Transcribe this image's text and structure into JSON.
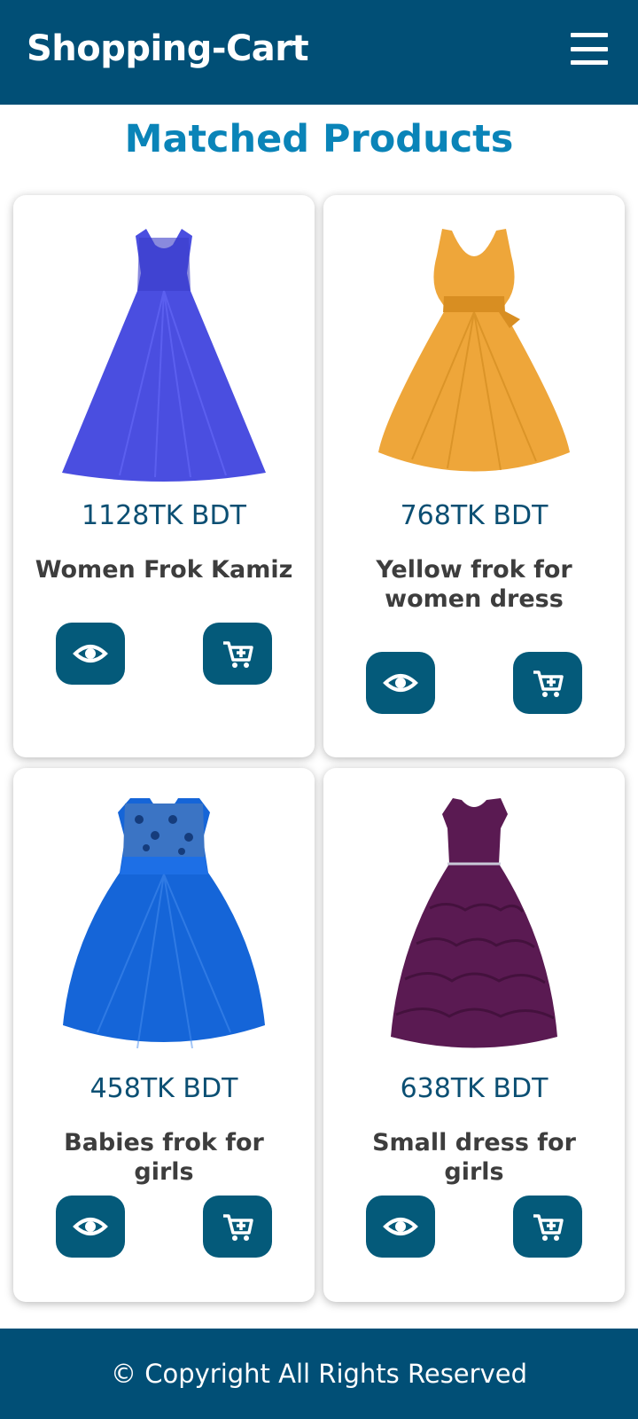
{
  "header": {
    "brand": "Shopping-Cart",
    "menu_icon": "hamburger-icon"
  },
  "page": {
    "heading": "Matched Products"
  },
  "colors": {
    "header_bg": "#014f76",
    "heading": "#0a84b8",
    "button_bg": "#045a7a",
    "price": "#0b4f73"
  },
  "products": [
    {
      "price": "1128TK BDT",
      "title": "Women Frok Kamiz",
      "dress_color": "#4a4ee0",
      "view_icon": "eye-icon",
      "cart_icon": "add-to-cart-icon"
    },
    {
      "price": "768TK BDT",
      "title": "Yellow frok for women dress",
      "dress_color": "#eea63a",
      "view_icon": "eye-icon",
      "cart_icon": "add-to-cart-icon"
    },
    {
      "price": "458TK BDT",
      "title": "Babies frok for girls",
      "dress_color": "#1565d8",
      "view_icon": "eye-icon",
      "cart_icon": "add-to-cart-icon"
    },
    {
      "price": "638TK BDT",
      "title": "Small dress for girls",
      "dress_color": "#5a1a52",
      "view_icon": "eye-icon",
      "cart_icon": "add-to-cart-icon"
    }
  ],
  "footer": {
    "text": "© Copyright All Rights Reserved"
  }
}
